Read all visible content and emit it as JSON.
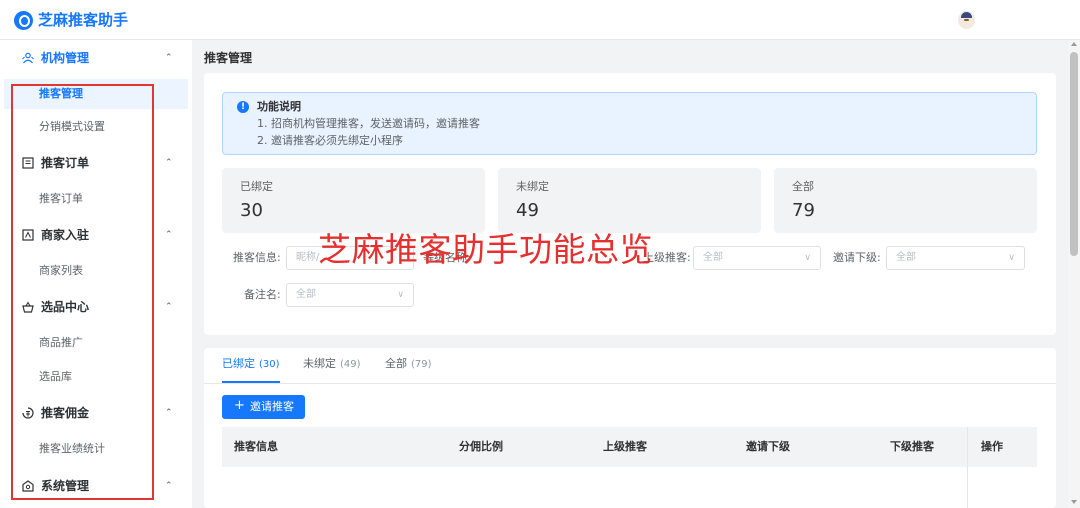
{
  "app": {
    "title": "芝麻推客助手"
  },
  "sidebar": {
    "groups": [
      {
        "label": "机构管理",
        "items": [
          "推客管理",
          "分销模式设置"
        ]
      },
      {
        "label": "推客订单",
        "items": [
          "推客订单"
        ]
      },
      {
        "label": "商家入驻",
        "items": [
          "商家列表"
        ]
      },
      {
        "label": "选品中心",
        "items": [
          "商品推广",
          "选品库"
        ]
      },
      {
        "label": "推客佣金",
        "items": [
          "推客业绩统计"
        ]
      },
      {
        "label": "系统管理",
        "items": []
      }
    ],
    "active_item": "推客管理"
  },
  "page": {
    "title": "推客管理"
  },
  "notice": {
    "title": "功能说明",
    "lines": [
      "1. 招商机构管理推客，发送邀请码，邀请推客",
      "2. 邀请推客必须先绑定小程序"
    ]
  },
  "stats": [
    {
      "label": "已绑定",
      "value": "30"
    },
    {
      "label": "未绑定",
      "value": "49"
    },
    {
      "label": "全部",
      "value": "79"
    }
  ],
  "filters": {
    "info_label": "推客信息:",
    "info_placeholder": "昵称/",
    "level_label": "等级名称:",
    "superior_label": "上级推客:",
    "superior_value": "全部",
    "invite_label": "邀请下级:",
    "invite_value": "全部",
    "remark_label": "备注名:",
    "remark_value": "全部"
  },
  "overlay_title": "芝麻推客助手功能总览",
  "tabs": [
    {
      "label": "已绑定",
      "count": "(30)"
    },
    {
      "label": "未绑定",
      "count": "(49)"
    },
    {
      "label": "全部",
      "count": "(79)"
    }
  ],
  "invite_button": "邀请推客",
  "table": {
    "columns": [
      "推客信息",
      "分佣比例",
      "上级推客",
      "邀请下级",
      "下级推客",
      "操作"
    ]
  },
  "colors": {
    "primary": "#1677ff",
    "annotation": "#e03636"
  }
}
